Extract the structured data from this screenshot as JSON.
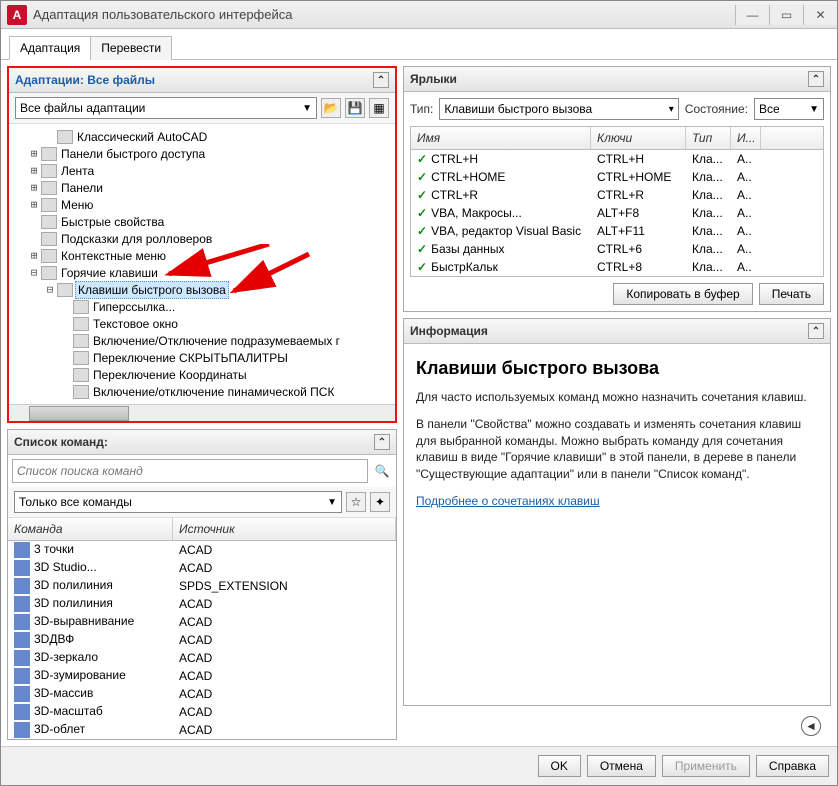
{
  "window": {
    "title": "Адаптация пользовательского интерфейса"
  },
  "tabs": {
    "t0": "Адаптация",
    "t1": "Перевести"
  },
  "adaptations": {
    "title": "Адаптации: Все файлы",
    "dropdown": "Все файлы адаптации",
    "tree": [
      {
        "level": 2,
        "toggle": "",
        "label": "Классический AutoCAD"
      },
      {
        "level": 1,
        "toggle": "+",
        "label": "Панели быстрого доступа"
      },
      {
        "level": 1,
        "toggle": "+",
        "label": "Лента"
      },
      {
        "level": 1,
        "toggle": "+",
        "label": "Панели"
      },
      {
        "level": 1,
        "toggle": "+",
        "label": "Меню"
      },
      {
        "level": 1,
        "toggle": "",
        "label": "Быстрые свойства"
      },
      {
        "level": 1,
        "toggle": "",
        "label": "Подсказки для ролловеров"
      },
      {
        "level": 1,
        "toggle": "+",
        "label": "Контекстные меню"
      },
      {
        "level": 1,
        "toggle": "-",
        "label": "Горячие клавиши"
      },
      {
        "level": 2,
        "toggle": "-",
        "label": "Клавиши быстрого вызова",
        "selected": true
      },
      {
        "level": 3,
        "toggle": "",
        "label": "Гиперссылка..."
      },
      {
        "level": 3,
        "toggle": "",
        "label": "Текстовое окно"
      },
      {
        "level": 3,
        "toggle": "",
        "label": "Включение/Отключение подразумеваемых г"
      },
      {
        "level": 3,
        "toggle": "",
        "label": "Переключение СКРЫТЬПАЛИТРЫ"
      },
      {
        "level": 3,
        "toggle": "",
        "label": "Переключение Координаты"
      },
      {
        "level": 3,
        "toggle": "",
        "label": "Включение/отключение пинамической ПСК"
      }
    ]
  },
  "command_list": {
    "title": "Список команд:",
    "search_placeholder": "Список поиска команд",
    "filter": "Только все команды",
    "col0": "Команда",
    "col1": "Источник",
    "rows": [
      {
        "c0": "3 точки",
        "c1": "ACAD"
      },
      {
        "c0": "3D Studio...",
        "c1": "ACAD"
      },
      {
        "c0": "3D полилиния",
        "c1": "SPDS_EXTENSION"
      },
      {
        "c0": "3D полилиния",
        "c1": "ACAD"
      },
      {
        "c0": "3D-выравнивание",
        "c1": "ACAD"
      },
      {
        "c0": "3DДВФ",
        "c1": "ACAD"
      },
      {
        "c0": "3D-зеркало",
        "c1": "ACAD"
      },
      {
        "c0": "3D-зумирование",
        "c1": "ACAD"
      },
      {
        "c0": "3D-массив",
        "c1": "ACAD"
      },
      {
        "c0": "3D-масштаб",
        "c1": "ACAD"
      },
      {
        "c0": "3D-облет",
        "c1": "ACAD"
      }
    ]
  },
  "shortcuts": {
    "title": "Ярлыки",
    "type_label": "Тип:",
    "type_value": "Клавиши быстрого вызова",
    "state_label": "Состояние:",
    "state_value": "Все",
    "col0": "Имя",
    "col1": "Ключи",
    "col2": "Тип",
    "col3": "И...",
    "rows": [
      {
        "c0": "CTRL+H",
        "c1": "CTRL+H",
        "c2": "Кла...",
        "c3": "A.."
      },
      {
        "c0": "CTRL+HOME",
        "c1": "CTRL+HOME",
        "c2": "Кла...",
        "c3": "A.."
      },
      {
        "c0": "CTRL+R",
        "c1": "CTRL+R",
        "c2": "Кла...",
        "c3": "A.."
      },
      {
        "c0": "VBA, Макросы...",
        "c1": "ALT+F8",
        "c2": "Кла...",
        "c3": "A.."
      },
      {
        "c0": "VBA, редактор Visual Basic",
        "c1": "ALT+F11",
        "c2": "Кла...",
        "c3": "A.."
      },
      {
        "c0": "Базы данных",
        "c1": "CTRL+6",
        "c2": "Кла...",
        "c3": "A.."
      },
      {
        "c0": "БыстрКальк",
        "c1": "CTRL+8",
        "c2": "Кла...",
        "c3": "A.."
      }
    ],
    "copy_btn": "Копировать в буфер",
    "print_btn": "Печать"
  },
  "info": {
    "title": "Информация",
    "heading": "Клавиши быстрого вызова",
    "p1": "Для часто используемых команд можно назначить сочетания клавиш.",
    "p2": "В панели \"Свойства\" можно создавать и изменять сочетания клавиш для выбранной команды. Можно выбрать команду для сочетания клавиш в виде \"Горячие клавиши\" в этой панели, в дереве в панели \"Существующие адаптации\" или в панели \"Список команд\".",
    "link": "Подробнее о сочетаниях клавиш"
  },
  "buttons": {
    "ok": "OK",
    "cancel": "Отмена",
    "apply": "Применить",
    "help": "Справка"
  }
}
